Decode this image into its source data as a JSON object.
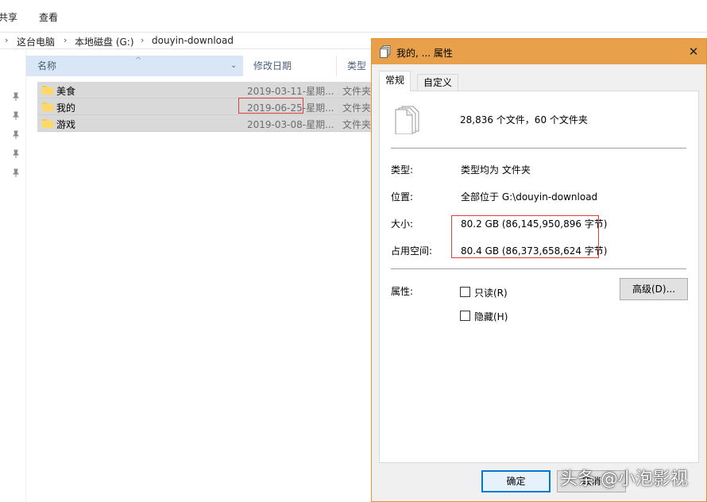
{
  "ribbon": {
    "share_tab": "共享",
    "view_tab": "查看"
  },
  "breadcrumb": {
    "this_pc": "这台电脑",
    "local_disk": "本地磁盘 (G:)",
    "folder": "douyin-download"
  },
  "columns": {
    "name": "名称",
    "date": "修改日期",
    "type": "类型"
  },
  "files": [
    {
      "name": "美食",
      "date": "2019-03-11-星期...",
      "type": "文件夹"
    },
    {
      "name": "我的",
      "date": "2019-06-25-星期...",
      "type": "文件夹"
    },
    {
      "name": "游戏",
      "date": "2019-03-08-星期...",
      "type": "文件夹"
    }
  ],
  "dialog": {
    "title": "我的, ... 属性",
    "tabs": {
      "general": "常规",
      "custom": "自定义"
    },
    "summary": "28,836 个文件，60 个文件夹",
    "type_label": "类型:",
    "type_value": "类型均为 文件夹",
    "location_label": "位置:",
    "location_value": "全部位于 G:\\douyin-download",
    "size_label": "大小:",
    "size_value": "80.2 GB (86,145,950,896 字节)",
    "disk_label": "占用空间:",
    "disk_value": "80.4 GB (86,373,658,624 字节)",
    "attr_label": "属性:",
    "readonly_label": "只读(R)",
    "hidden_label": "隐藏(H)",
    "advanced_button": "高级(D)...",
    "ok_button": "确定",
    "cancel_button": "取消"
  },
  "watermark": "头条 @小泡影视",
  "colors": {
    "titlebar": "#e9a04a",
    "highlight_box": "#e23b3b",
    "ok_border": "#0078d7"
  }
}
